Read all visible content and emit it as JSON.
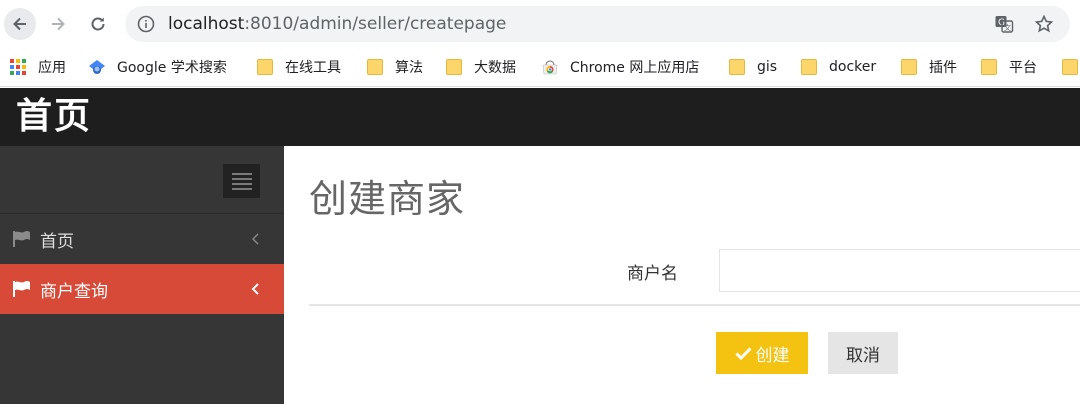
{
  "browser": {
    "url_host": "localhost",
    "url_path": ":8010/admin/seller/createpage",
    "bookmarks": [
      {
        "label": "应用",
        "icon": "apps-grid-icon"
      },
      {
        "label": "Google 学术搜索",
        "icon": "google-scholar-icon"
      },
      {
        "label": "在线工具",
        "icon": "folder-icon"
      },
      {
        "label": "算法",
        "icon": "folder-icon"
      },
      {
        "label": "大数据",
        "icon": "folder-icon"
      },
      {
        "label": "Chrome 网上应用店",
        "icon": "chrome-webstore-icon"
      },
      {
        "label": "gis",
        "icon": "folder-icon"
      },
      {
        "label": "docker",
        "icon": "folder-icon"
      },
      {
        "label": "插件",
        "icon": "folder-icon"
      },
      {
        "label": "平台",
        "icon": "folder-icon"
      }
    ]
  },
  "header": {
    "brand": "首页",
    "bg_color": "#1e1e1e"
  },
  "sidebar": {
    "items": [
      {
        "label": "首页",
        "icon": "flag-icon",
        "active": false
      },
      {
        "label": "商户查询",
        "icon": "flag-icon",
        "active": true
      }
    ],
    "active_color": "#d84a38"
  },
  "main": {
    "title": "创建商家",
    "form": {
      "merchant_name_label": "商户名",
      "merchant_name_value": "",
      "create_label": "创建",
      "cancel_label": "取消"
    },
    "create_color": "#f4c311"
  }
}
